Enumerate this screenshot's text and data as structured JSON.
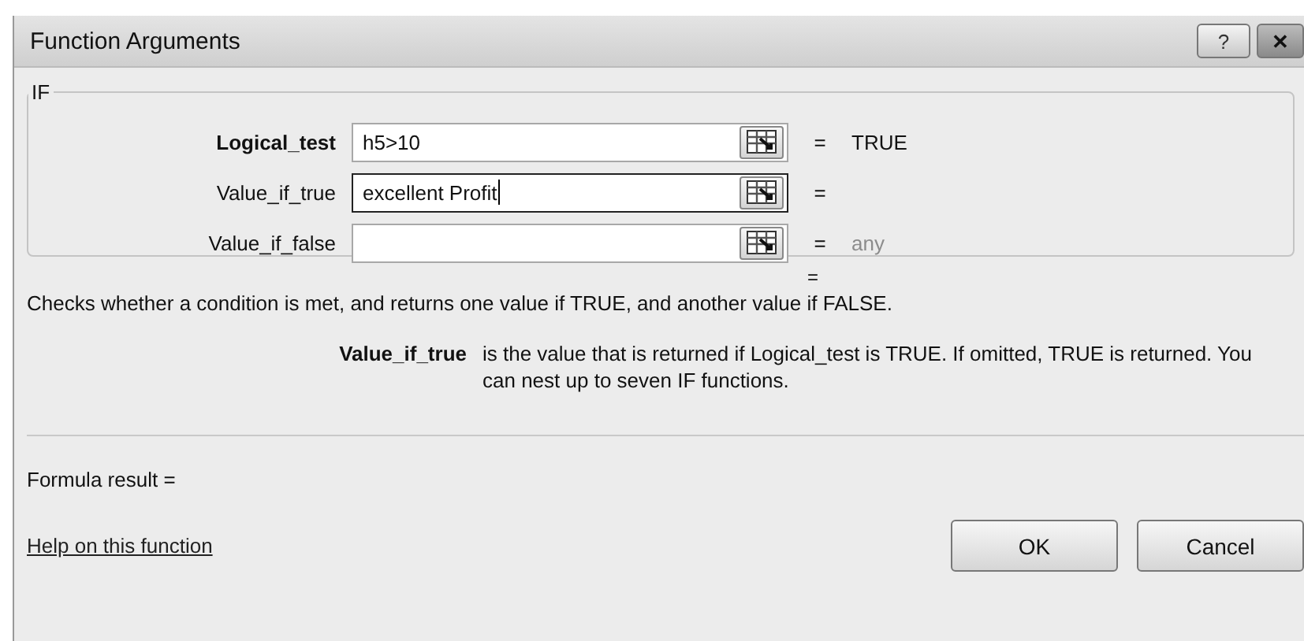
{
  "window": {
    "title": "Function Arguments",
    "buttons": [
      "?",
      "✕"
    ]
  },
  "function": {
    "name": "IF",
    "arguments": [
      {
        "label": "Logical_test",
        "required": true,
        "value": "h5>10",
        "focused": false,
        "equals": "=",
        "result": "TRUE",
        "dimmed": false
      },
      {
        "label": "Value_if_true",
        "required": false,
        "value": "excellent Profit",
        "focused": true,
        "equals": "="
      },
      {
        "label": "Value_if_false",
        "required": false,
        "focused": false,
        "equals": "=",
        "result": "any",
        "dimmed": true
      }
    ],
    "overall_result": "=",
    "description": "Checks whether a condition is met, and returns one value if TRUE, and another value if FALSE.",
    "argument_help": {
      "label": "Value_if_true",
      "text": "is the value that is returned if Logical_test is TRUE. If omitted, TRUE is returned. You can nest up to seven IF functions."
    }
  },
  "formula_result": "Formula result =",
  "help_link": "Help on this function",
  "buttons": [
    "OK",
    "Cancel"
  ]
}
